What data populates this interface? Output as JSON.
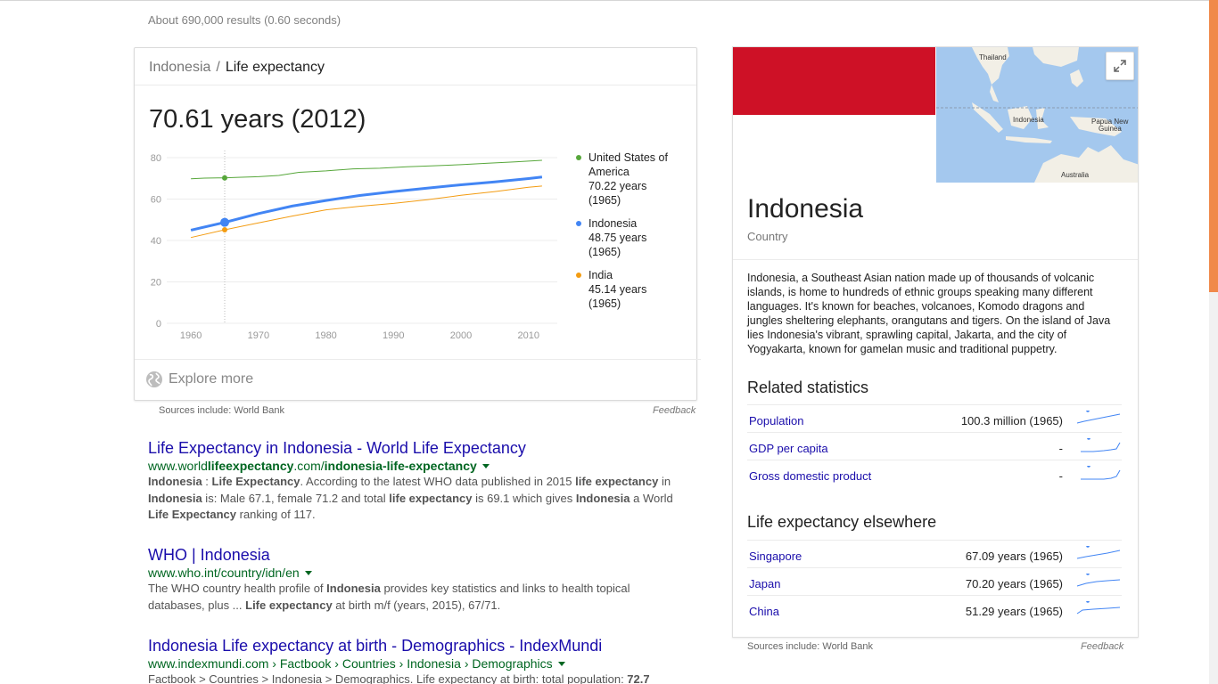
{
  "results_count": "About 690,000 results (0.60 seconds)",
  "chart_card": {
    "breadcrumb_country": "Indonesia",
    "breadcrumb_separator": "/",
    "breadcrumb_topic": "Life expectancy",
    "headline": "70.61 years (2012)",
    "explore_label": "Explore more",
    "sources": "Sources include: World Bank",
    "feedback": "Feedback"
  },
  "chart_data": {
    "type": "line",
    "title": "70.61 years (2012)",
    "xlabel": "",
    "ylabel": "",
    "xlim": [
      1958,
      2014
    ],
    "ylim": [
      0,
      80
    ],
    "x_ticks": [
      "1960",
      "1970",
      "1980",
      "1990",
      "2000",
      "2010"
    ],
    "y_ticks": [
      "0",
      "20",
      "40",
      "60",
      "80"
    ],
    "grid": true,
    "highlight_year": 1965,
    "series": [
      {
        "name": "United States of America",
        "color": "#57a73b",
        "x": [
          1960,
          1962,
          1964,
          1965,
          1967,
          1970,
          1973,
          1976,
          1980,
          1984,
          1988,
          1992,
          1996,
          2000,
          2004,
          2008,
          2012
        ],
        "y": [
          69.8,
          70.1,
          70.2,
          70.22,
          70.5,
          70.8,
          71.4,
          72.9,
          73.6,
          74.6,
          74.9,
          75.6,
          76.1,
          76.6,
          77.3,
          78.0,
          78.7
        ]
      },
      {
        "name": "Indonesia",
        "color": "#4285f4",
        "x": [
          1960,
          1965,
          1970,
          1975,
          1980,
          1985,
          1990,
          1995,
          2000,
          2005,
          2010,
          2012
        ],
        "y": [
          45.0,
          48.75,
          53.0,
          56.6,
          59.3,
          61.7,
          63.6,
          65.3,
          66.9,
          68.3,
          69.9,
          70.61
        ]
      },
      {
        "name": "India",
        "color": "#f39c12",
        "x": [
          1960,
          1965,
          1970,
          1975,
          1980,
          1985,
          1990,
          1995,
          2000,
          2005,
          2010,
          2012
        ],
        "y": [
          41.4,
          45.14,
          48.5,
          51.8,
          54.8,
          56.5,
          57.9,
          59.7,
          61.8,
          63.6,
          65.7,
          66.3
        ]
      }
    ],
    "legend": [
      {
        "name_line1": "United States of",
        "name_line2": "America",
        "value": "70.22 years",
        "year": "(1965)",
        "color": "#57a73b"
      },
      {
        "name_line1": "Indonesia",
        "name_line2": "",
        "value": "48.75 years",
        "year": "(1965)",
        "color": "#4285f4"
      },
      {
        "name_line1": "India",
        "name_line2": "",
        "value": "45.14 years",
        "year": "(1965)",
        "color": "#f39c12"
      }
    ],
    "legend_placement": "right"
  },
  "results": [
    {
      "title": "Life Expectancy in Indonesia - World Life Expectancy",
      "url_pre": "www.world",
      "url_bold": "lifeexpectancy",
      "url_mid": ".com/",
      "url_bold2": "indonesia-life-expectancy",
      "snippet_html": "<b>Indonesia</b> : <b>Life Expectancy</b>. According to the latest WHO data published in 2015 <b>life expectancy</b> in <b>Indonesia</b> is: Male 67.1, female 71.2 and total <b>life expectancy</b> is 69.1 which gives <b>Indonesia</b> a World <b>Life Expectancy</b> ranking of 117."
    },
    {
      "title": "WHO | Indonesia",
      "url": "www.who.int/country/idn/en",
      "snippet_html": "The WHO country health profile of <b>Indonesia</b> provides key statistics and links to health topical databases, plus ... <b>Life expectancy</b> at birth m/f (years, 2015), 67/71."
    },
    {
      "title": "Indonesia Life expectancy at birth - Demographics - IndexMundi",
      "url": "www.indexmundi.com › Factbook › Countries › Indonesia › Demographics",
      "snippet_html": "Factbook > Countries > Indonesia > Demographics. Life expectancy at birth: total population: <b>72.7</b>"
    }
  ],
  "knowledge_panel": {
    "title": "Indonesia",
    "subtitle": "Country",
    "description": "Indonesia, a Southeast Asian nation made up of thousands of volcanic islands, is home to hundreds of ethnic groups speaking many different languages. It's known for beaches, volcanoes, Komodo dragons and jungles sheltering elephants, orangutans and tigers. On the island of Java lies Indonesia's vibrant, sprawling capital, Jakarta, and the city of Yogyakarta, known for gamelan music and traditional puppetry.",
    "map_labels": {
      "thailand": "Thailand",
      "indonesia": "Indonesia",
      "papua1": "Papua New",
      "papua2": "Guinea",
      "australia": "Australia"
    },
    "flag_colors": {
      "top": "#ce1126",
      "bottom": "#ffffff"
    },
    "related_heading": "Related statistics",
    "related": [
      {
        "name": "Population",
        "value": "100.3 million (1965)"
      },
      {
        "name": "GDP per capita",
        "value": "-"
      },
      {
        "name": "Gross domestic product",
        "value": "-"
      }
    ],
    "elsewhere_heading": "Life expectancy elsewhere",
    "elsewhere": [
      {
        "name": "Singapore",
        "value": "67.09 years (1965)"
      },
      {
        "name": "Japan",
        "value": "70.20 years (1965)"
      },
      {
        "name": "China",
        "value": "51.29 years (1965)"
      }
    ],
    "sources": "Sources include: World Bank",
    "feedback": "Feedback"
  },
  "colors": {
    "link": "#1a0dab",
    "url": "#006621",
    "accent_scroll": "#f0894a"
  }
}
